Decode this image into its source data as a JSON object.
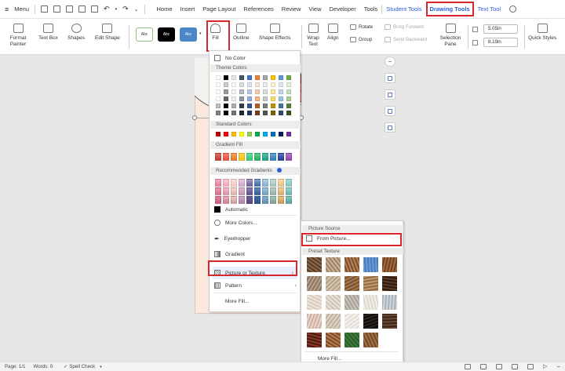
{
  "menubar": {
    "menu_label": "Menu",
    "tabs": [
      "Home",
      "Insert",
      "Page Layout",
      "References",
      "Review",
      "View",
      "Developer",
      "Tools"
    ],
    "context_tabs": [
      "Student Tools",
      "Drawing Tools",
      "Text Tool"
    ],
    "active_tab": "Drawing Tools"
  },
  "ribbon": {
    "format_painter": "Format Painter",
    "text_box": "Text Box",
    "shapes": "Shapes",
    "edit_shape": "Edit Shape",
    "style_sample": "Abc",
    "fill": "Fill",
    "outline": "Outline",
    "shape_effects": "Shape Effects",
    "wrap_text": "Wrap Text",
    "align": "Align",
    "rotate": "Rotate",
    "group": "Group",
    "bring_forward": "Bring Forward",
    "send_backward": "Send Backward",
    "selection_pane": "Selection Pane",
    "height_value": "5.05in",
    "width_value": "8.19in",
    "quick_styles": "Quick Styles"
  },
  "fill_menu": {
    "no_color": "No Color",
    "theme_colors": "Theme Colors",
    "standard_colors": "Standard Colors",
    "gradient_fill": "Gradient Fill",
    "recommended_gradients": "Recommended Gradients",
    "automatic": "Automatic",
    "more_colors": "More Colors...",
    "eyedropper": "Eyedropper",
    "gradient": "Gradient",
    "picture_or_texture": "Picture or Texture",
    "pattern": "Pattern",
    "more_fill": "More Fill..."
  },
  "texture_menu": {
    "picture_source": "Picture Source",
    "from_picture": "From Picture...",
    "preset_texture": "Preset Texture",
    "more_fill": "More Fill..."
  },
  "status": {
    "page": "Page: 1/1",
    "words": "Words: 0",
    "spell_check": "Spell Check"
  },
  "colors": {
    "accent": "#2b5fd9",
    "highlight": "#d9272e",
    "theme_top_row": [
      "#ffffff",
      "#000000",
      "#e7e6e6",
      "#44546a",
      "#4472c4",
      "#ed7d31",
      "#a5a5a5",
      "#ffc000",
      "#5b9bd5",
      "#70ad47"
    ],
    "standard": [
      "#c00000",
      "#ff0000",
      "#ffc000",
      "#ffff00",
      "#92d050",
      "#00b050",
      "#00b0f0",
      "#0070c0",
      "#002060",
      "#7030a0"
    ],
    "gradient_fill": [
      "#c0392b",
      "#e74c3c",
      "#e67e22",
      "#f1c40f",
      "#2ecc71",
      "#27ae60",
      "#16a085",
      "#2980b9",
      "#1f3a93",
      "#8e44ad"
    ]
  }
}
